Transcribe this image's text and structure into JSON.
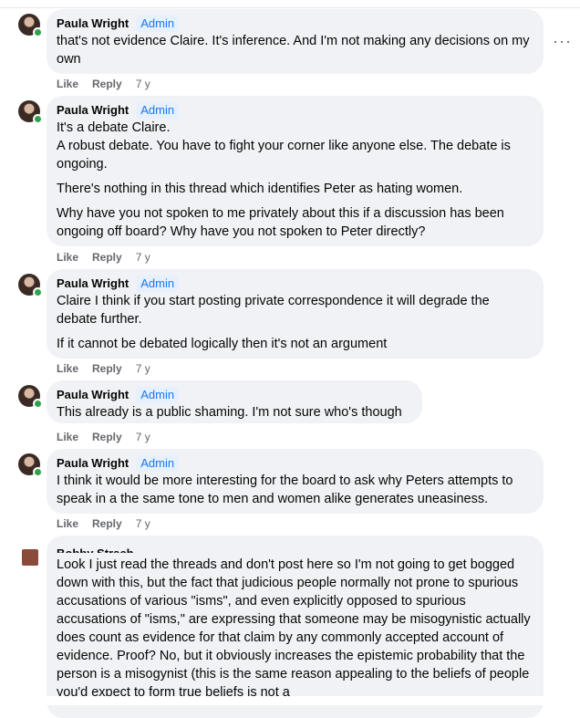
{
  "comments": [
    {
      "author": "Paula Wright",
      "badge": "Admin",
      "paragraphs": [
        "that's not evidence Claire. It's inference. And I'm not making any decisions on my own"
      ],
      "like": "Like",
      "reply": "Reply",
      "time": "7 y"
    },
    {
      "author": "Paula Wright",
      "badge": "Admin",
      "paragraphs": [
        "It's a debate Claire.",
        "A robust debate. You have to fight your corner like anyone else. The debate is ongoing.",
        "There's nothing in this thread which identifies Peter as hating women.",
        "Why have you not spoken to me privately about this if a discussion has been ongoing off board? Why have you not spoken to Peter directly?"
      ],
      "like": "Like",
      "reply": "Reply",
      "time": "7 y"
    },
    {
      "author": "Paula Wright",
      "badge": "Admin",
      "paragraphs": [
        "Claire I think if you start posting private correspondence it will degrade the debate further.",
        "If it cannot be debated logically then it's not an argument"
      ],
      "like": "Like",
      "reply": "Reply",
      "time": "7 y"
    },
    {
      "author": "Paula Wright",
      "badge": "Admin",
      "paragraphs": [
        "This already is a public shaming. I'm not sure who's though"
      ],
      "like": "Like",
      "reply": "Reply",
      "time": "7 y"
    },
    {
      "author": "Paula Wright",
      "badge": "Admin",
      "paragraphs": [
        "I think it would be more interesting for the board to ask why Peters attempts to speak in a the same tone to men and women alike generates uneasiness."
      ],
      "like": "Like",
      "reply": "Reply",
      "time": "7 y"
    }
  ],
  "last_comment": {
    "author_partial": "Bobby Strach",
    "text": "Look I just read the threads and don't post here so I'm not going to get bogged down with this, but the fact that judicious people normally not prone to spurious accusations of various \"isms\", and even explicitly opposed to spurious accusations of \"isms,\" are expressing that someone may be misogynistic actually does count as evidence for that claim by any commonly accepted account of evidence. Proof? No, but it obviously increases the epistemic probability that the person is a misogynist (this is the same reason appealing to the beliefs of people you'd expect to form true beliefs is not a"
  },
  "more_label": "···"
}
